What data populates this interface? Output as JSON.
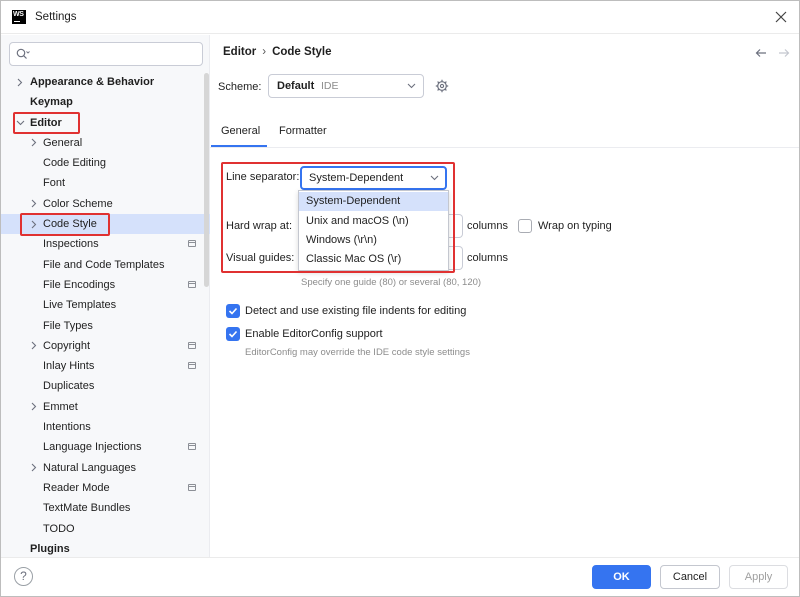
{
  "window": {
    "title": "Settings",
    "app_logo": "WS"
  },
  "sidebar": {
    "search": {
      "placeholder": "",
      "value": ""
    },
    "items": [
      {
        "label": "Appearance & Behavior",
        "bold": true,
        "chevron": "right",
        "level": 0
      },
      {
        "label": "Keymap",
        "bold": true,
        "chevron": "none",
        "level": 0
      },
      {
        "label": "Editor",
        "bold": true,
        "chevron": "down",
        "level": 0
      },
      {
        "label": "General",
        "bold": false,
        "chevron": "right",
        "level": 1
      },
      {
        "label": "Code Editing",
        "bold": false,
        "chevron": "none",
        "level": 1
      },
      {
        "label": "Font",
        "bold": false,
        "chevron": "none",
        "level": 1
      },
      {
        "label": "Color Scheme",
        "bold": false,
        "chevron": "right",
        "level": 1
      },
      {
        "label": "Code Style",
        "bold": false,
        "chevron": "right",
        "level": 1,
        "selected": true
      },
      {
        "label": "Inspections",
        "bold": false,
        "chevron": "none",
        "level": 1,
        "project_icon": true
      },
      {
        "label": "File and Code Templates",
        "bold": false,
        "chevron": "none",
        "level": 1
      },
      {
        "label": "File Encodings",
        "bold": false,
        "chevron": "none",
        "level": 1,
        "project_icon": true
      },
      {
        "label": "Live Templates",
        "bold": false,
        "chevron": "none",
        "level": 1
      },
      {
        "label": "File Types",
        "bold": false,
        "chevron": "none",
        "level": 1
      },
      {
        "label": "Copyright",
        "bold": false,
        "chevron": "right",
        "level": 1,
        "project_icon": true
      },
      {
        "label": "Inlay Hints",
        "bold": false,
        "chevron": "none",
        "level": 1,
        "project_icon": true
      },
      {
        "label": "Duplicates",
        "bold": false,
        "chevron": "none",
        "level": 1
      },
      {
        "label": "Emmet",
        "bold": false,
        "chevron": "right",
        "level": 1
      },
      {
        "label": "Intentions",
        "bold": false,
        "chevron": "none",
        "level": 1
      },
      {
        "label": "Language Injections",
        "bold": false,
        "chevron": "none",
        "level": 1,
        "project_icon": true
      },
      {
        "label": "Natural Languages",
        "bold": false,
        "chevron": "right",
        "level": 1
      },
      {
        "label": "Reader Mode",
        "bold": false,
        "chevron": "none",
        "level": 1,
        "project_icon": true
      },
      {
        "label": "TextMate Bundles",
        "bold": false,
        "chevron": "none",
        "level": 1
      },
      {
        "label": "TODO",
        "bold": false,
        "chevron": "none",
        "level": 1
      },
      {
        "label": "Plugins",
        "bold": true,
        "chevron": "none",
        "level": 0
      }
    ]
  },
  "breadcrumb": {
    "parent": "Editor",
    "current": "Code Style",
    "separator": "›"
  },
  "scheme": {
    "label": "Scheme:",
    "value": "Default",
    "sub": "IDE"
  },
  "tabs": [
    {
      "label": "General",
      "active": true
    },
    {
      "label": "Formatter",
      "active": false
    }
  ],
  "general": {
    "line_separator_label": "Line separator:",
    "line_separator_value": "System-Dependent",
    "line_separator_options": [
      "System-Dependent",
      "Unix and macOS (\\n)",
      "Windows (\\r\\n)",
      "Classic Mac OS (\\r)"
    ],
    "hard_wrap_label": "Hard wrap at:",
    "hard_wrap_units": "columns",
    "wrap_on_typing_label": "Wrap on typing",
    "wrap_on_typing_checked": false,
    "visual_guides_label": "Visual guides:",
    "visual_guides_units": "columns",
    "visual_guides_hint": "Specify one guide (80) or several (80, 120)",
    "detect_indents_label": "Detect and use existing file indents for editing",
    "detect_indents_checked": true,
    "editorconfig_label": "Enable EditorConfig support",
    "editorconfig_checked": true,
    "editorconfig_hint": "EditorConfig may override the IDE code style settings"
  },
  "footer": {
    "help": "?",
    "ok": "OK",
    "cancel": "Cancel",
    "apply": "Apply"
  },
  "colors": {
    "accent": "#3574f0",
    "selection": "#d5e1fb",
    "highlight": "#e03131"
  }
}
